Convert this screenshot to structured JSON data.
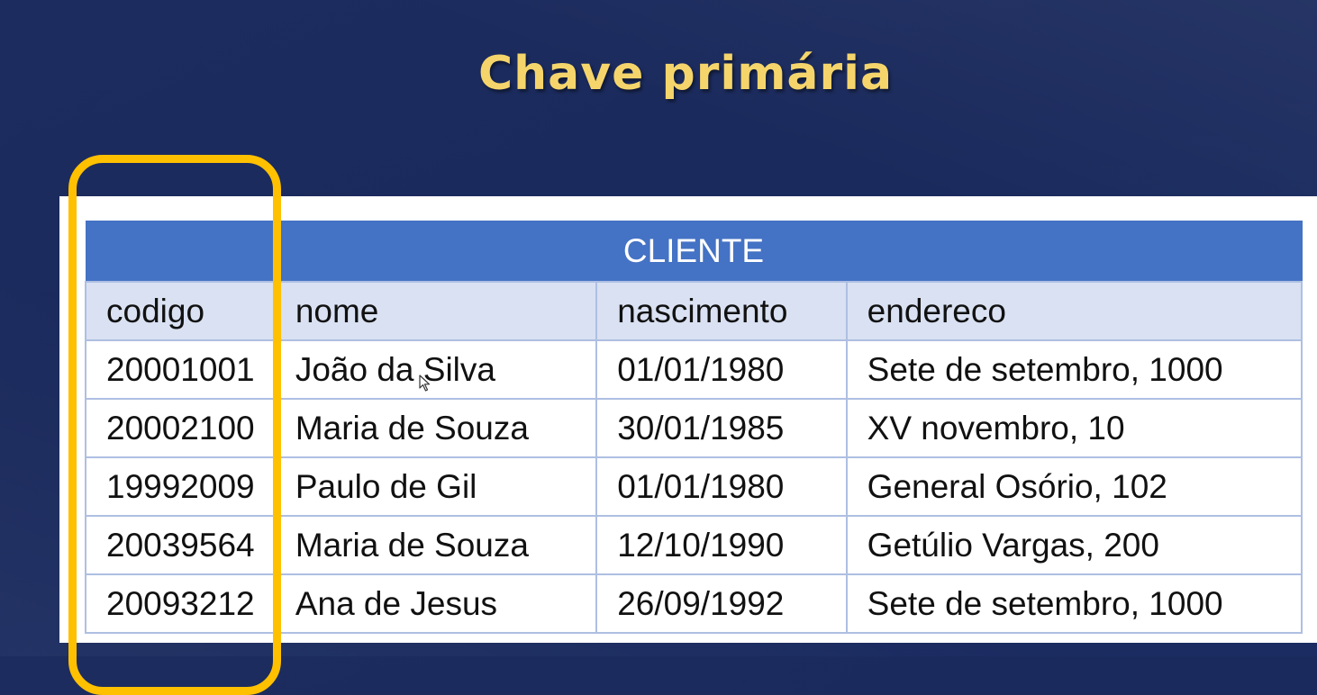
{
  "slide": {
    "title": "Chave primária"
  },
  "table": {
    "entity_name": "CLIENTE",
    "columns": [
      "codigo",
      "nome",
      "nascimento",
      "endereco"
    ],
    "rows": [
      [
        "20001001",
        "João da Silva",
        "01/01/1980",
        "Sete de setembro, 1000"
      ],
      [
        "20002100",
        "Maria de Souza",
        "30/01/1985",
        "XV novembro, 10"
      ],
      [
        "19992009",
        "Paulo de Gil",
        "01/01/1980",
        "General Osório, 102"
      ],
      [
        "20039564",
        "Maria de Souza",
        "12/10/1990",
        "Getúlio Vargas, 200"
      ],
      [
        "20093212",
        "Ana de Jesus",
        "26/09/1992",
        "Sete de setembro, 1000"
      ]
    ]
  },
  "highlight": {
    "target_column": "codigo",
    "color": "#ffc000"
  },
  "colors": {
    "background": "#1d2c5f",
    "title": "#f5d56b",
    "table_header": "#4472c4",
    "column_header": "#d9e1f2",
    "grid": "#aebfe2"
  },
  "icons": {
    "cursor": "mouse-pointer-icon"
  }
}
